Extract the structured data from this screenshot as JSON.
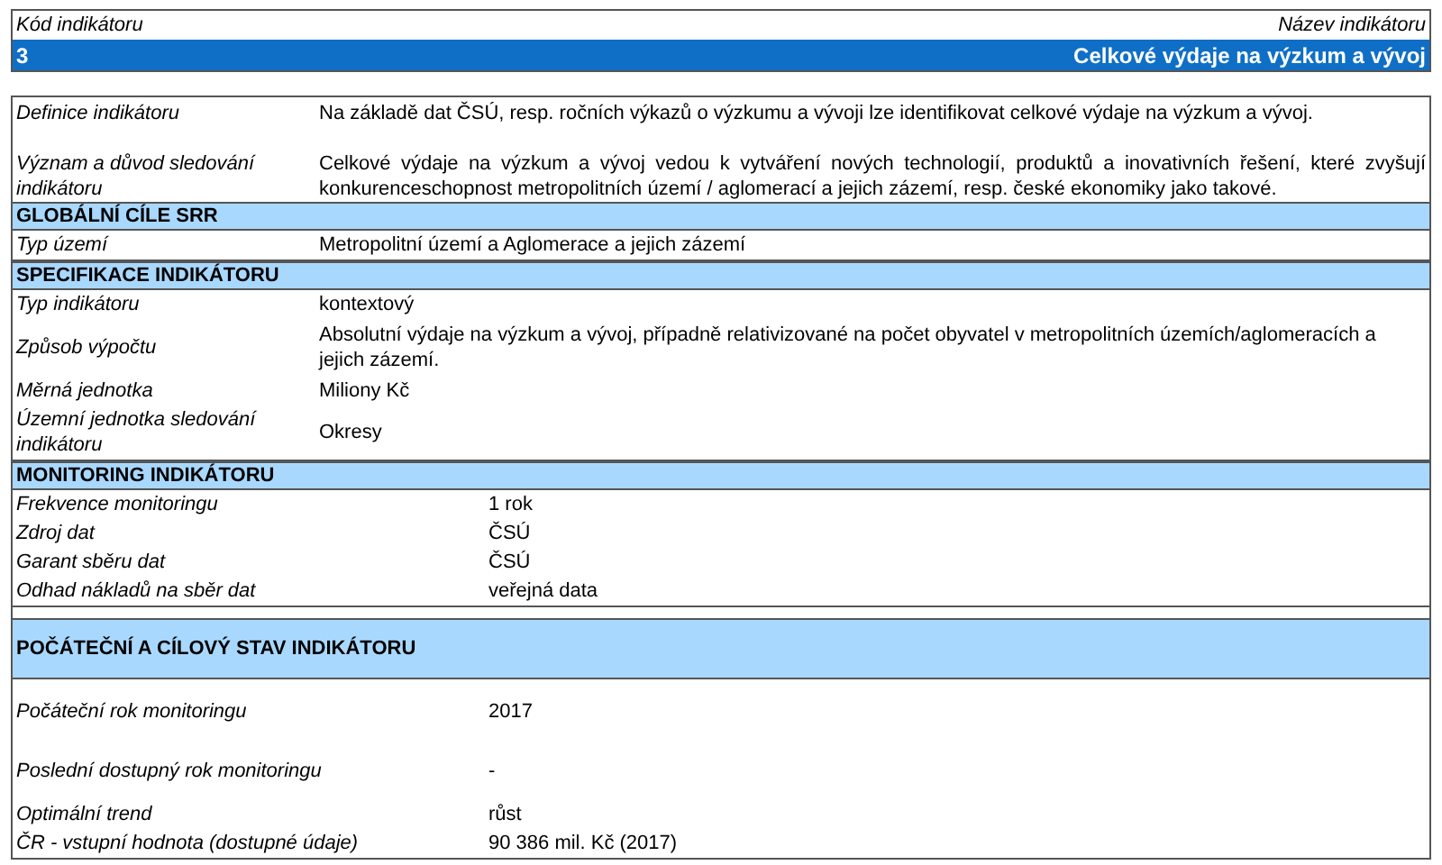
{
  "header": {
    "code_label": "Kód indikátoru",
    "name_label": "Název indikátoru",
    "code": "3",
    "name": "Celkové výdaje na výzkum a vývoj"
  },
  "intro": [
    {
      "label": "Definice indikátoru",
      "value": "Na základě dat ČSÚ, resp. ročních výkazů o výzkumu a vývoji lze identifikovat celkové výdaje na výzkum a vývoj."
    },
    {
      "label": "Význam a důvod sledování indikátoru",
      "value": "Celkové výdaje na výzkum a vývoj vedou k vytváření nových technologií, produktů a inovativních řešení, které zvyšují konkurenceschopnost metropolitních území / aglomerací a jejich zázemí, resp. české ekonomiky jako takové."
    }
  ],
  "sections": [
    {
      "title": "GLOBÁLNÍ CÍLE SRR",
      "rows": [
        {
          "label": "Typ území",
          "value": "Metropolitní území a Aglomerace a jejich zázemí"
        }
      ]
    },
    {
      "title": "SPECIFIKACE INDIKÁTORU",
      "rows": [
        {
          "label": "Typ indikátoru",
          "value": "kontextový"
        },
        {
          "label": "Způsob výpočtu",
          "value": "Absolutní výdaje na výzkum a vývoj, případně relativizované na počet obyvatel v metropolitních územích/aglomeracích a jejich zázemí."
        },
        {
          "label": "Měrná jednotka",
          "value": "Miliony Kč"
        },
        {
          "label": "Územní jednotka sledování indikátoru",
          "value": "Okresy"
        }
      ]
    },
    {
      "title": "MONITORING INDIKÁTORU",
      "rows": [
        {
          "label": "Frekvence monitoringu",
          "value": "1 rok"
        },
        {
          "label": "Zdroj dat",
          "value": "ČSÚ"
        },
        {
          "label": "Garant sběru dat",
          "value": "ČSÚ"
        },
        {
          "label": "Odhad nákladů na sběr dat",
          "value": "veřejná data"
        }
      ]
    },
    {
      "title": "POČÁTEČNÍ A CÍLOVÝ STAV INDIKÁTORU",
      "rows": [
        {
          "label": "Počáteční rok monitoringu",
          "value": "2017"
        },
        {
          "label": "Poslední dostupný rok monitoringu",
          "value": "-"
        },
        {
          "label": "Optimální trend",
          "value": "růst"
        },
        {
          "label": "ČR - vstupní hodnota (dostupné údaje)",
          "value": "90 386 mil. Kč (2017)"
        }
      ]
    }
  ]
}
